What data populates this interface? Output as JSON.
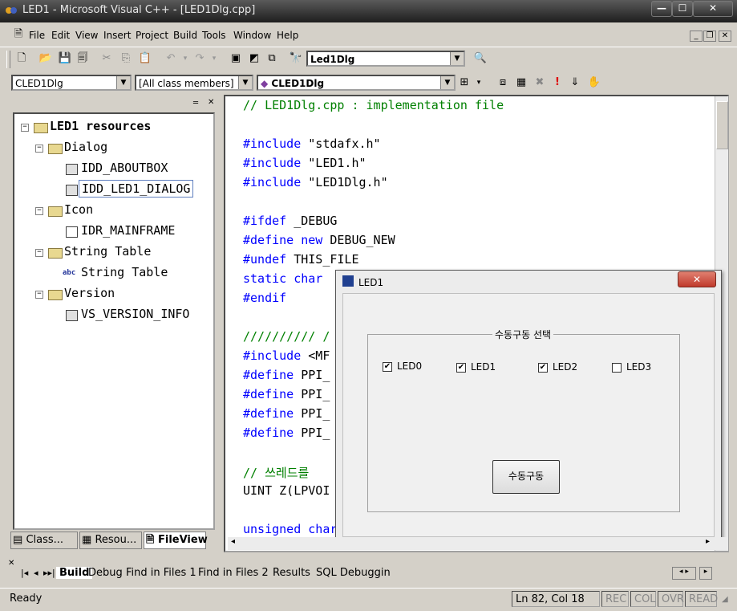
{
  "window": {
    "title": "LED1 - Microsoft Visual C++ - [LED1Dlg.cpp]",
    "min": "—",
    "max": "☐",
    "close": "✕"
  },
  "menu": [
    "File",
    "Edit",
    "View",
    "Insert",
    "Project",
    "Build",
    "Tools",
    "Window",
    "Help"
  ],
  "toolbar": {
    "find_combo": "Led1Dlg"
  },
  "wizardbar": {
    "class_combo": "CLED1Dlg",
    "filter_combo": "[All class members]",
    "member_combo": "CLED1Dlg"
  },
  "workspace": {
    "tree": {
      "root": "LED1 resources",
      "dialog": "Dialog",
      "dialog_items": [
        "IDD_ABOUTBOX",
        "IDD_LED1_DIALOG"
      ],
      "icon": "Icon",
      "icon_items": [
        "IDR_MAINFRAME"
      ],
      "string_table": "String Table",
      "string_table_items": [
        "String Table"
      ],
      "version": "Version",
      "version_items": [
        "VS_VERSION_INFO"
      ]
    },
    "tabs": [
      "Class...",
      "Resou...",
      "FileView"
    ]
  },
  "editor": {
    "lines": [
      {
        "type": "cm",
        "text": "// LED1Dlg.cpp : implementation file"
      },
      {
        "type": "blank",
        "text": ""
      },
      {
        "type": "inc",
        "kw": "#include",
        "rest": " \"stdafx.h\""
      },
      {
        "type": "inc",
        "kw": "#include",
        "rest": " \"LED1.h\""
      },
      {
        "type": "inc",
        "kw": "#include",
        "rest": " \"LED1Dlg.h\""
      },
      {
        "type": "blank",
        "text": ""
      },
      {
        "type": "inc",
        "kw": "#ifdef",
        "rest": " _DEBUG"
      },
      {
        "type": "define_new",
        "kw": "#define",
        "kw2": "new",
        "rest": " DEBUG_NEW"
      },
      {
        "type": "inc",
        "kw": "#undef",
        "rest": " THIS_FILE"
      },
      {
        "type": "static",
        "kw": "static",
        "kw2": "char",
        "rest": ""
      },
      {
        "type": "inc",
        "kw": "#endif",
        "rest": ""
      },
      {
        "type": "blank",
        "text": ""
      },
      {
        "type": "cm",
        "text": "////////// /"
      },
      {
        "type": "inc",
        "kw": "#include",
        "rest": " <MF"
      },
      {
        "type": "inc",
        "kw": "#define",
        "rest": " PPI_"
      },
      {
        "type": "inc",
        "kw": "#define",
        "rest": " PPI_"
      },
      {
        "type": "inc",
        "kw": "#define",
        "rest": " PPI_"
      },
      {
        "type": "inc",
        "kw": "#define",
        "rest": " PPI_"
      },
      {
        "type": "blank",
        "text": ""
      },
      {
        "type": "cm",
        "text": "// 쓰레드를"
      },
      {
        "type": "plain",
        "text": "UINT Z(LPVOI"
      },
      {
        "type": "blank",
        "text": ""
      },
      {
        "type": "static",
        "kw": "unsigned",
        "kw2": "char",
        "rest": ""
      }
    ]
  },
  "dialog": {
    "title": "LED1",
    "close": "✕",
    "group_label": "수동구동 선택",
    "checkboxes": [
      {
        "label": "LED0",
        "checked": true
      },
      {
        "label": "LED1",
        "checked": true
      },
      {
        "label": "LED2",
        "checked": true
      },
      {
        "label": "LED3",
        "checked": false
      }
    ],
    "button": "수동구동"
  },
  "output": {
    "tabs": [
      "Build",
      "Debug",
      "Find in Files 1",
      "Find in Files 2",
      "Results",
      "SQL Debuggin"
    ]
  },
  "status": {
    "ready": "Ready",
    "position": "Ln 82, Col 18",
    "rec": "REC",
    "col": "COL",
    "ovr": "OVR",
    "read": "READ"
  }
}
